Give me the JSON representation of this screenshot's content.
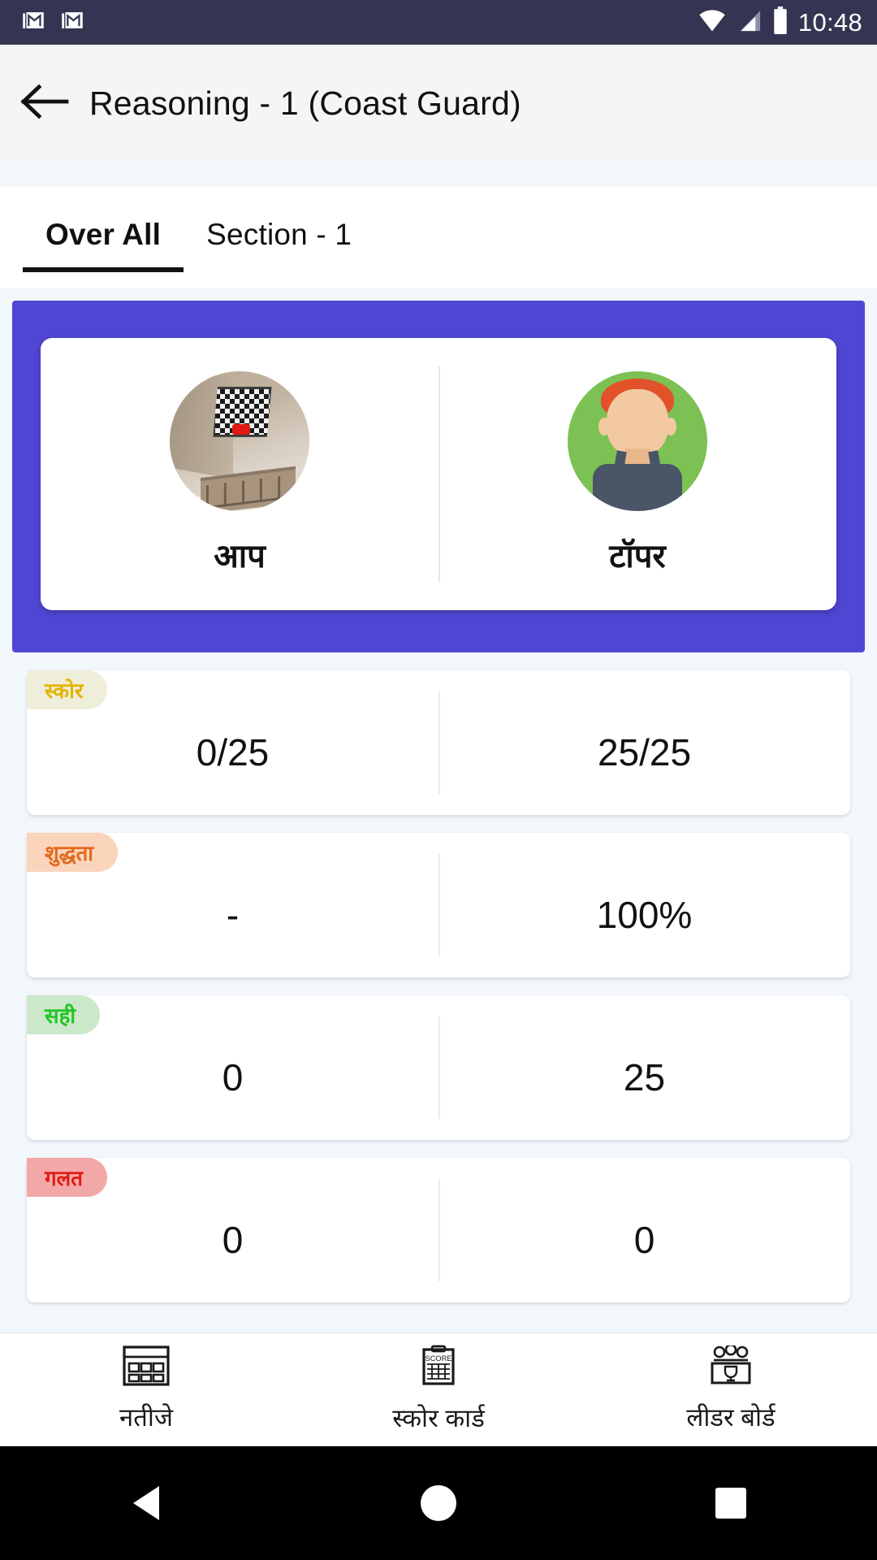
{
  "status_bar": {
    "time": "10:48",
    "icons": [
      "gmail-icon",
      "gmail-icon",
      "wifi-icon",
      "cellular-signal-icon",
      "battery-icon"
    ],
    "background_color": "#343552"
  },
  "toolbar": {
    "back_label": "back-arrow",
    "title": "Reasoning - 1 (Coast Guard)"
  },
  "tabs": [
    {
      "label": "Over All",
      "active": true
    },
    {
      "label": "Section - 1",
      "active": false
    }
  ],
  "hero": {
    "background_color": "#5046D4",
    "columns": [
      {
        "avatar": "user-photo-avatar",
        "label": "आप"
      },
      {
        "avatar": "topper-cartoon-avatar",
        "label": "टॉपर"
      }
    ]
  },
  "metrics": [
    {
      "badge": "स्कोर",
      "badge_bg": "#EFEEDA",
      "badge_color": "#E2B400",
      "you": "0/25",
      "topper": "25/25"
    },
    {
      "badge": "शुद्धता",
      "badge_bg": "#FBD4BC",
      "badge_color": "#E2691C",
      "you": "-",
      "topper": "100%"
    },
    {
      "badge": "सही",
      "badge_bg": "#CBE8CB",
      "badge_color": "#22C522",
      "you": "0",
      "topper": "25"
    },
    {
      "badge": "गलत",
      "badge_bg": "#F3A8A8",
      "badge_color": "#E01B12",
      "you": "0",
      "topper": "0"
    }
  ],
  "bottom_nav": [
    {
      "icon": "results-grid-icon",
      "label": "नतीजे"
    },
    {
      "icon": "score-card-icon",
      "label": "स्कोर कार्ड"
    },
    {
      "icon": "leader-board-icon",
      "label": "लीडर बोर्ड"
    }
  ],
  "android_nav": [
    "back-triangle-icon",
    "home-circle-icon",
    "recents-square-icon"
  ]
}
